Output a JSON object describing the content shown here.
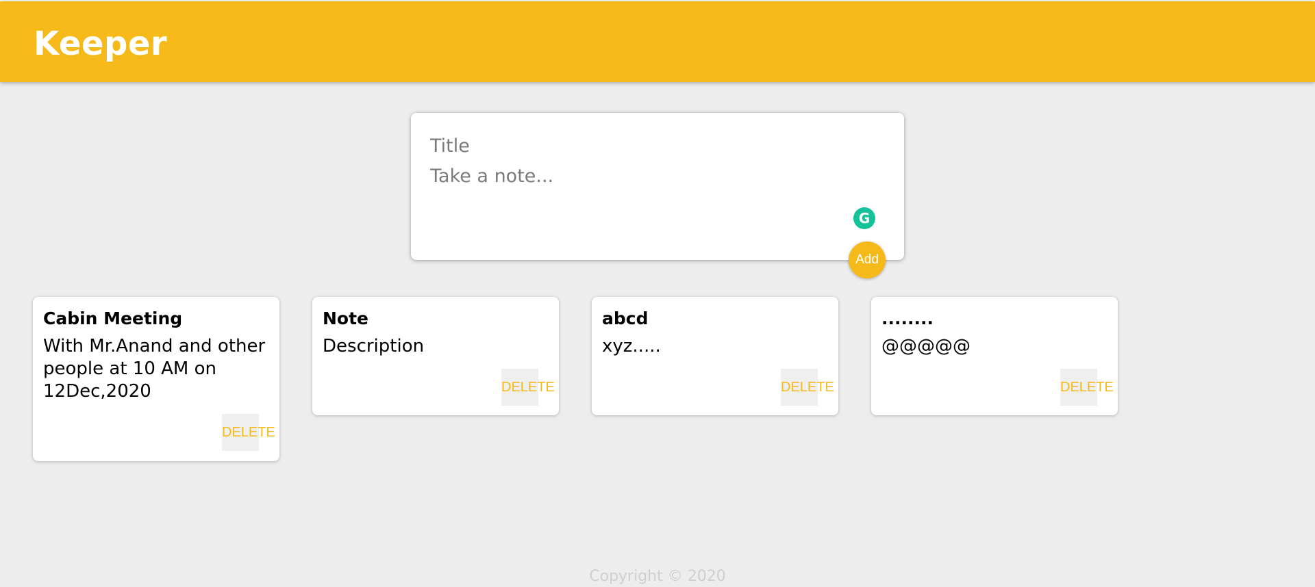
{
  "app": {
    "title": "Keeper",
    "accent_color": "#f5ba19"
  },
  "create_note": {
    "title_placeholder": "Title",
    "content_placeholder": "Take a note...",
    "grammarly_icon": "G",
    "add_label": "Add"
  },
  "notes": [
    {
      "title": "Cabin Meeting",
      "content": "With Mr.Anand and other people at 10 AM on 12Dec,2020",
      "delete_label": "DELETE"
    },
    {
      "title": "Note",
      "content": "Description",
      "delete_label": "DELETE"
    },
    {
      "title": "abcd",
      "content": "xyz.....",
      "delete_label": "DELETE"
    },
    {
      "title": "........",
      "content": "@@@@@",
      "delete_label": "DELETE"
    }
  ],
  "footer": {
    "text": "Copyright © 2020"
  }
}
